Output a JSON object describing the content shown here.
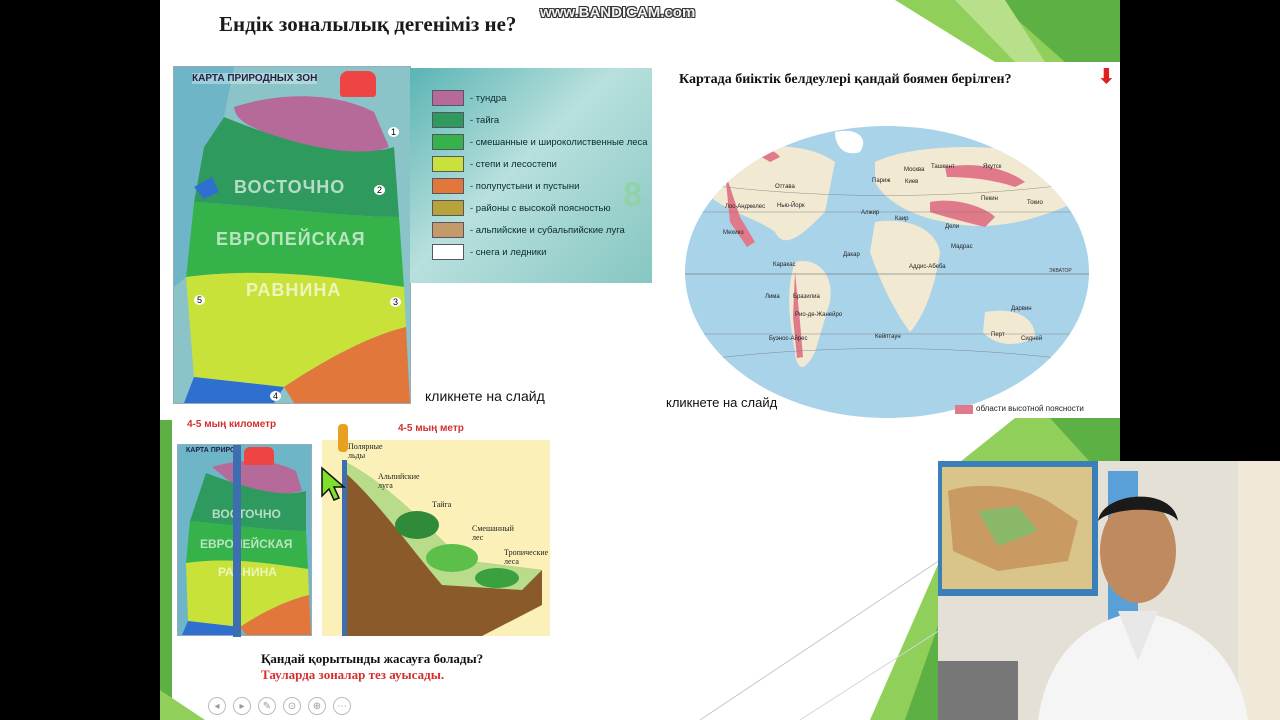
{
  "watermark": "www.BANDICAM.com",
  "slide": {
    "title": "Ендік зоналылық дегеніміз не?",
    "right_question": "Картада биіктік белдеулері қандай боямен берілген?",
    "hint_left": "кликнете на слайд",
    "hint_right": "кликнете на слайд",
    "label_km": "4-5 мың километр",
    "label_m": "4-5 мың метр",
    "bottom_question": "Қандай қорытынды жасауға болады?",
    "bottom_answer": "Тауларда зоналар тез ауысады."
  },
  "zones_map": {
    "title": "КАРТА ПРИРОДНЫХ ЗОН",
    "line1": "ВОСТОЧНО",
    "line2": "ЕВРОПЕЙСКАЯ",
    "line3": "РАВНИНА",
    "markers": [
      "1",
      "2",
      "3",
      "4",
      "5"
    ]
  },
  "small_map": {
    "title": "КАРТА ПРИРО",
    "line1": "ВОСТОЧНО",
    "line2": "ЕВРОПЕЙСКАЯ",
    "line3": "РАВНИНА"
  },
  "legend": {
    "items": [
      {
        "label": "- тундра",
        "color": "#b56a9a"
      },
      {
        "label": "- тайга",
        "color": "#2e9a5e"
      },
      {
        "label": "- смешанные и широколиственные леса",
        "color": "#35b24a"
      },
      {
        "label": "- степи и лесостепи",
        "color": "#c9e23a"
      },
      {
        "label": "- полупустыни и пустыни",
        "color": "#e2773c"
      },
      {
        "label": "- районы с высокой поясностью",
        "color": "#b8a23a"
      },
      {
        "label": "- альпийские и субальпийские луга",
        "color": "#c59a6a"
      },
      {
        "label": "- снега и ледники",
        "color": "#ffffff"
      }
    ],
    "number": "8"
  },
  "world_map": {
    "legend_label": "области высотной поясности",
    "equator_label": "ЭКВАТОР",
    "cities": [
      "Якутск",
      "Москва",
      "Париж",
      "Киев",
      "Ташкент",
      "Пекин",
      "Токио",
      "Оттава",
      "Нью-Йорк",
      "Лос-Анджелес",
      "Алжир",
      "Каир",
      "Дели",
      "Мехико",
      "Каракас",
      "Дакар",
      "Аддис-Абеба",
      "Мадрас",
      "Лима",
      "Бразилиа",
      "Рио-де-Жанейро",
      "Буэнос-Айрес",
      "Кейптаун",
      "Перт",
      "Сидней",
      "Дарвин"
    ]
  },
  "profile": {
    "labels": [
      "Полярные льды",
      "Альпийские луга",
      "Тайга",
      "Смешанный лес",
      "Тропические леса"
    ]
  },
  "controls": [
    "◂",
    "▸",
    "✎",
    "⊙",
    "⊕",
    "⋯"
  ]
}
